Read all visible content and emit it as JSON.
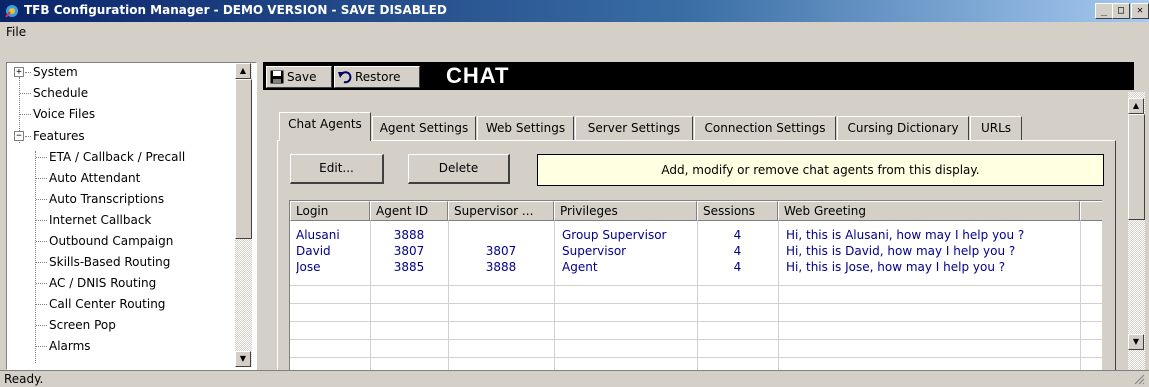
{
  "window": {
    "title": "TFB Configuration Manager - DEMO VERSION - SAVE DISABLED",
    "controls": {
      "minimize": "_",
      "maximize": "□",
      "close": "✕"
    }
  },
  "menu": {
    "file": "File"
  },
  "tree": {
    "items": [
      {
        "label": "System",
        "expander": "+"
      },
      {
        "label": "Schedule"
      },
      {
        "label": "Voice Files"
      },
      {
        "label": "Features",
        "expander": "−"
      },
      {
        "label": "ETA / Callback / Precall"
      },
      {
        "label": "Auto Attendant"
      },
      {
        "label": "Auto Transcriptions"
      },
      {
        "label": "Internet Callback"
      },
      {
        "label": "Outbound Campaign"
      },
      {
        "label": "Skills-Based Routing"
      },
      {
        "label": "AC / DNIS Routing"
      },
      {
        "label": "Call Center Routing"
      },
      {
        "label": "Screen Pop"
      },
      {
        "label": "Alarms"
      }
    ]
  },
  "toolbar": {
    "save_label": "Save",
    "restore_label": "Restore"
  },
  "page_title": "CHAT",
  "tabs": [
    {
      "label": "Chat Agents",
      "active": true
    },
    {
      "label": "Agent Settings"
    },
    {
      "label": "Web Settings"
    },
    {
      "label": "Server Settings"
    },
    {
      "label": "Connection Settings"
    },
    {
      "label": "Cursing Dictionary"
    },
    {
      "label": "URLs"
    }
  ],
  "actions": {
    "edit_label": "Edit...",
    "delete_label": "Delete"
  },
  "info_text": "Add, modify or remove chat agents from this display.",
  "grid": {
    "columns": [
      "Login",
      "Agent ID",
      "Supervisor ...",
      "Privileges",
      "Sessions",
      "Web Greeting"
    ],
    "rows": [
      [
        "Alusani",
        "3888",
        "",
        "Group Supervisor",
        "4",
        "Hi, this is Alusani, how may I help you ?"
      ],
      [
        "David",
        "3807",
        "3807",
        "Supervisor",
        "4",
        "Hi, this is David, how may I help you ?"
      ],
      [
        "Jose",
        "3885",
        "3888",
        "Agent",
        "4",
        "Hi, this is Jose, how may I help you ?"
      ]
    ]
  },
  "status": {
    "text": "Ready."
  },
  "colors": {
    "title_gradient_start": "#0a246a",
    "grid_text": "#00008b",
    "info_bg": "#ffffe1",
    "header_bg": "#000000"
  }
}
